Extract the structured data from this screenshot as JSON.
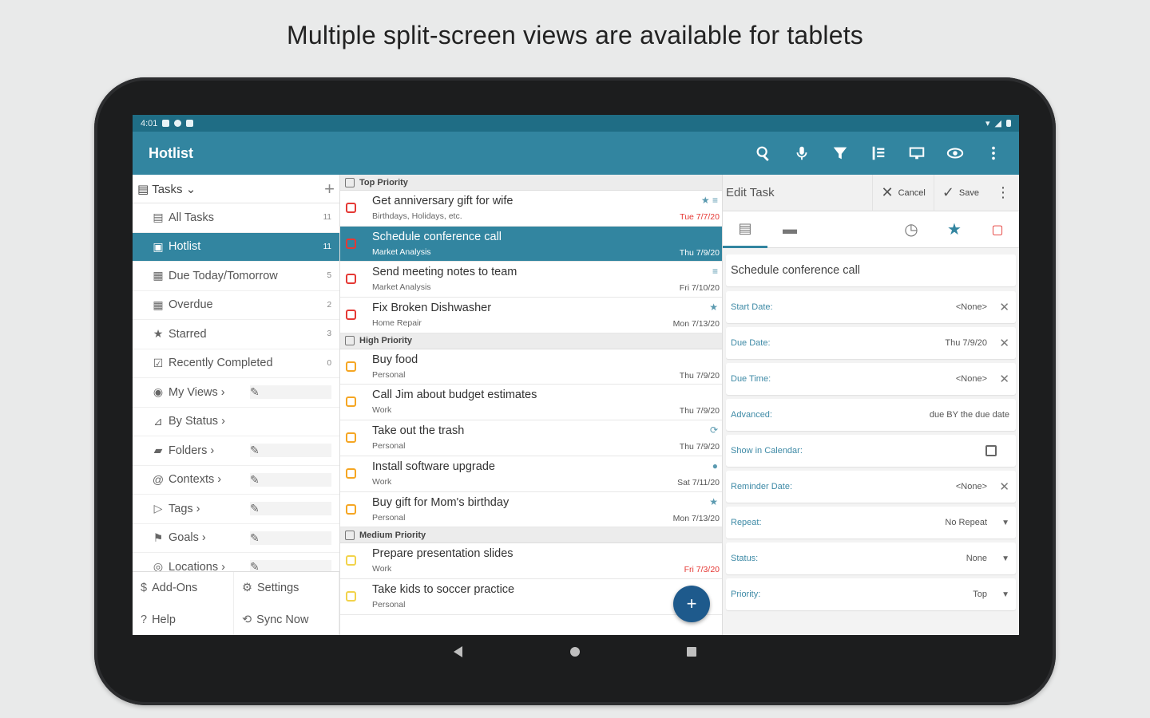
{
  "banner": "Multiple split-screen views are available for tablets",
  "status_bar": {
    "time": "4:01"
  },
  "app": {
    "title": "Hotlist"
  },
  "toolbar_icons": [
    "search-icon",
    "mic-icon",
    "filter-icon",
    "sort-icon",
    "display-icon",
    "eye-icon",
    "overflow-icon"
  ],
  "nav": {
    "header": "Tasks",
    "items": [
      {
        "label": "All Tasks",
        "count": "11"
      },
      {
        "label": "Hotlist",
        "count": "11"
      },
      {
        "label": "Due Today/Tomorrow",
        "count": "5"
      },
      {
        "label": "Overdue",
        "count": "2"
      },
      {
        "label": "Starred",
        "count": "3"
      },
      {
        "label": "Recently Completed",
        "count": "0"
      },
      {
        "label": "My Views"
      },
      {
        "label": "By Status"
      },
      {
        "label": "Folders"
      },
      {
        "label": "Contexts"
      },
      {
        "label": "Tags"
      },
      {
        "label": "Goals"
      },
      {
        "label": "Locations"
      }
    ],
    "bottom": {
      "addons": "Add-Ons",
      "settings": "Settings",
      "help": "Help",
      "sync": "Sync Now"
    }
  },
  "list": {
    "groups": [
      {
        "title": "Top Priority",
        "tasks": [
          {
            "title": "Get anniversary gift for wife",
            "folder": "Birthdays, Holidays, etc.",
            "due": "Tue 7/7/20"
          },
          {
            "title": "Schedule conference call",
            "folder": "Market Analysis",
            "due": "Thu 7/9/20"
          },
          {
            "title": "Send meeting notes to team",
            "folder": "Market Analysis",
            "due": "Fri 7/10/20"
          },
          {
            "title": "Fix Broken Dishwasher",
            "folder": "Home Repair",
            "due": "Mon 7/13/20"
          }
        ]
      },
      {
        "title": "High Priority",
        "tasks": [
          {
            "title": "Buy food",
            "folder": "Personal",
            "due": "Thu 7/9/20"
          },
          {
            "title": "Call Jim about budget estimates",
            "folder": "Work",
            "due": "Thu 7/9/20"
          },
          {
            "title": "Take out the trash",
            "folder": "Personal",
            "due": "Thu 7/9/20"
          },
          {
            "title": "Install software upgrade",
            "folder": "Work",
            "due": "Sat 7/11/20"
          },
          {
            "title": "Buy gift for Mom's birthday",
            "folder": "Personal",
            "due": "Mon 7/13/20"
          }
        ]
      },
      {
        "title": "Medium Priority",
        "tasks": [
          {
            "title": "Prepare presentation slides",
            "folder": "Work",
            "due": "Fri 7/3/20"
          },
          {
            "title": "Take kids to soccer practice",
            "folder": "Personal",
            "due": ""
          }
        ]
      }
    ]
  },
  "edit": {
    "title": "Edit Task",
    "cancel": "Cancel",
    "save": "Save",
    "task_name": "Schedule conference call",
    "fields": [
      {
        "label": "Start Date:",
        "value": "<None>"
      },
      {
        "label": "Due Date:",
        "value": "Thu 7/9/20"
      },
      {
        "label": "Due Time:",
        "value": "<None>"
      },
      {
        "label": "Advanced:",
        "value": "due BY the due date"
      },
      {
        "label": "Show in Calendar:",
        "value": ""
      },
      {
        "label": "Reminder Date:",
        "value": "<None>"
      },
      {
        "label": "Repeat:",
        "value": "No Repeat"
      },
      {
        "label": "Status:",
        "value": "None"
      },
      {
        "label": "Priority:",
        "value": "Top"
      }
    ]
  },
  "colors": {
    "app_bar": "#3285a0",
    "status_bar": "#1f6d85",
    "selection": "#3285a0",
    "top_priority": "#e53935",
    "high_priority": "#f5a623",
    "medium_priority": "#f2d34b",
    "fab": "#1e5a8c"
  }
}
